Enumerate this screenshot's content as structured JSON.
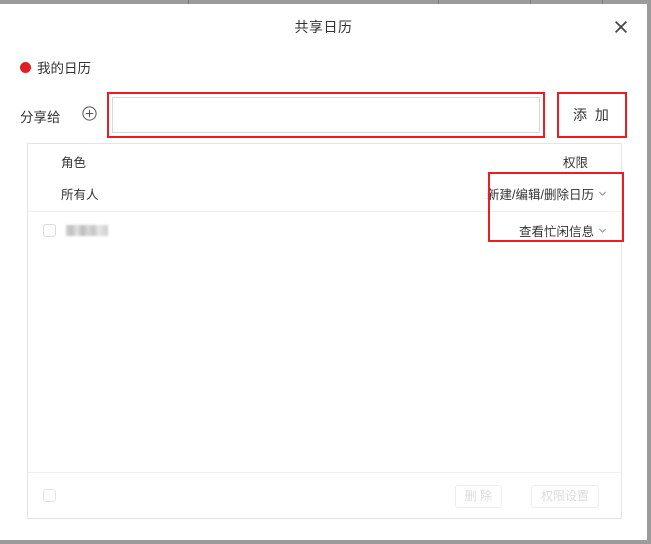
{
  "dialog": {
    "title": "共享日历",
    "close_icon": "close-icon"
  },
  "calendar": {
    "dot_color": "#e02020",
    "name": "我的日历"
  },
  "share": {
    "label": "分享给",
    "add_icon": "plus-circle-icon",
    "input_value": "",
    "input_placeholder": "",
    "add_button_label": "添 加"
  },
  "table": {
    "columns": {
      "role": "角色",
      "permission": "权限"
    },
    "rows": [
      {
        "role": "所有人",
        "permission": "新建/编辑/删除日历",
        "has_checkbox": false,
        "redacted": false,
        "checked": false
      },
      {
        "role": "",
        "permission": "查看忙闲信息",
        "has_checkbox": true,
        "redacted": true,
        "checked": false
      }
    ]
  },
  "footer": {
    "select_all_checked": false,
    "delete_label": "删 除",
    "permission_settings_label": "权限设置",
    "buttons_disabled": true
  },
  "annotations": {
    "color": "#ed1c24",
    "boxes": [
      "share-input",
      "add-button",
      "permission-dropdowns"
    ]
  }
}
